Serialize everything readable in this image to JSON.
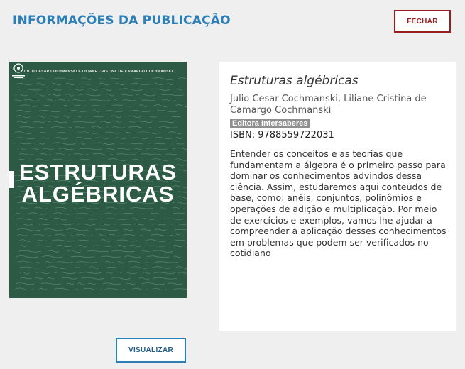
{
  "header": {
    "title": "INFORMAÇÕES DA PUBLICAÇÃO",
    "close_label": "FECHAR"
  },
  "cover": {
    "authors": "JULIO CESAR COCHMANSKI E LILIANE CRISTINA DE CAMARGO COCHMANSKI",
    "title_line1": "ESTRUTURAS",
    "title_line2": "ALGÉBRICAS",
    "publisher_logo_text": "Intersaberes",
    "background_color": "#2d5a44"
  },
  "book": {
    "title": "Estruturas algébricas",
    "authors": "Julio Cesar Cochmanski, Liliane Cristina de Camargo Cochmanski",
    "publisher": "Editora Intersaberes",
    "isbn": "ISBN: 9788559722031",
    "description": "Entender os conceitos e as teorias que fundamentam a álgebra é o primeiro passo para dominar os conhecimentos advindos dessa ciência. Assim, estudaremos aqui conteúdos de base, como: anéis, conjuntos, polinômios e operações de adição e multiplicação. Por meio de exercícios e exemplos, vamos lhe ajudar a compreender a aplicação desses conhecimentos em problemas que podem ser verificados no cotidiano"
  },
  "actions": {
    "view_label": "VISUALIZAR"
  },
  "colors": {
    "accent_blue": "#2a7fb8",
    "close_red": "#9b1c1c"
  }
}
